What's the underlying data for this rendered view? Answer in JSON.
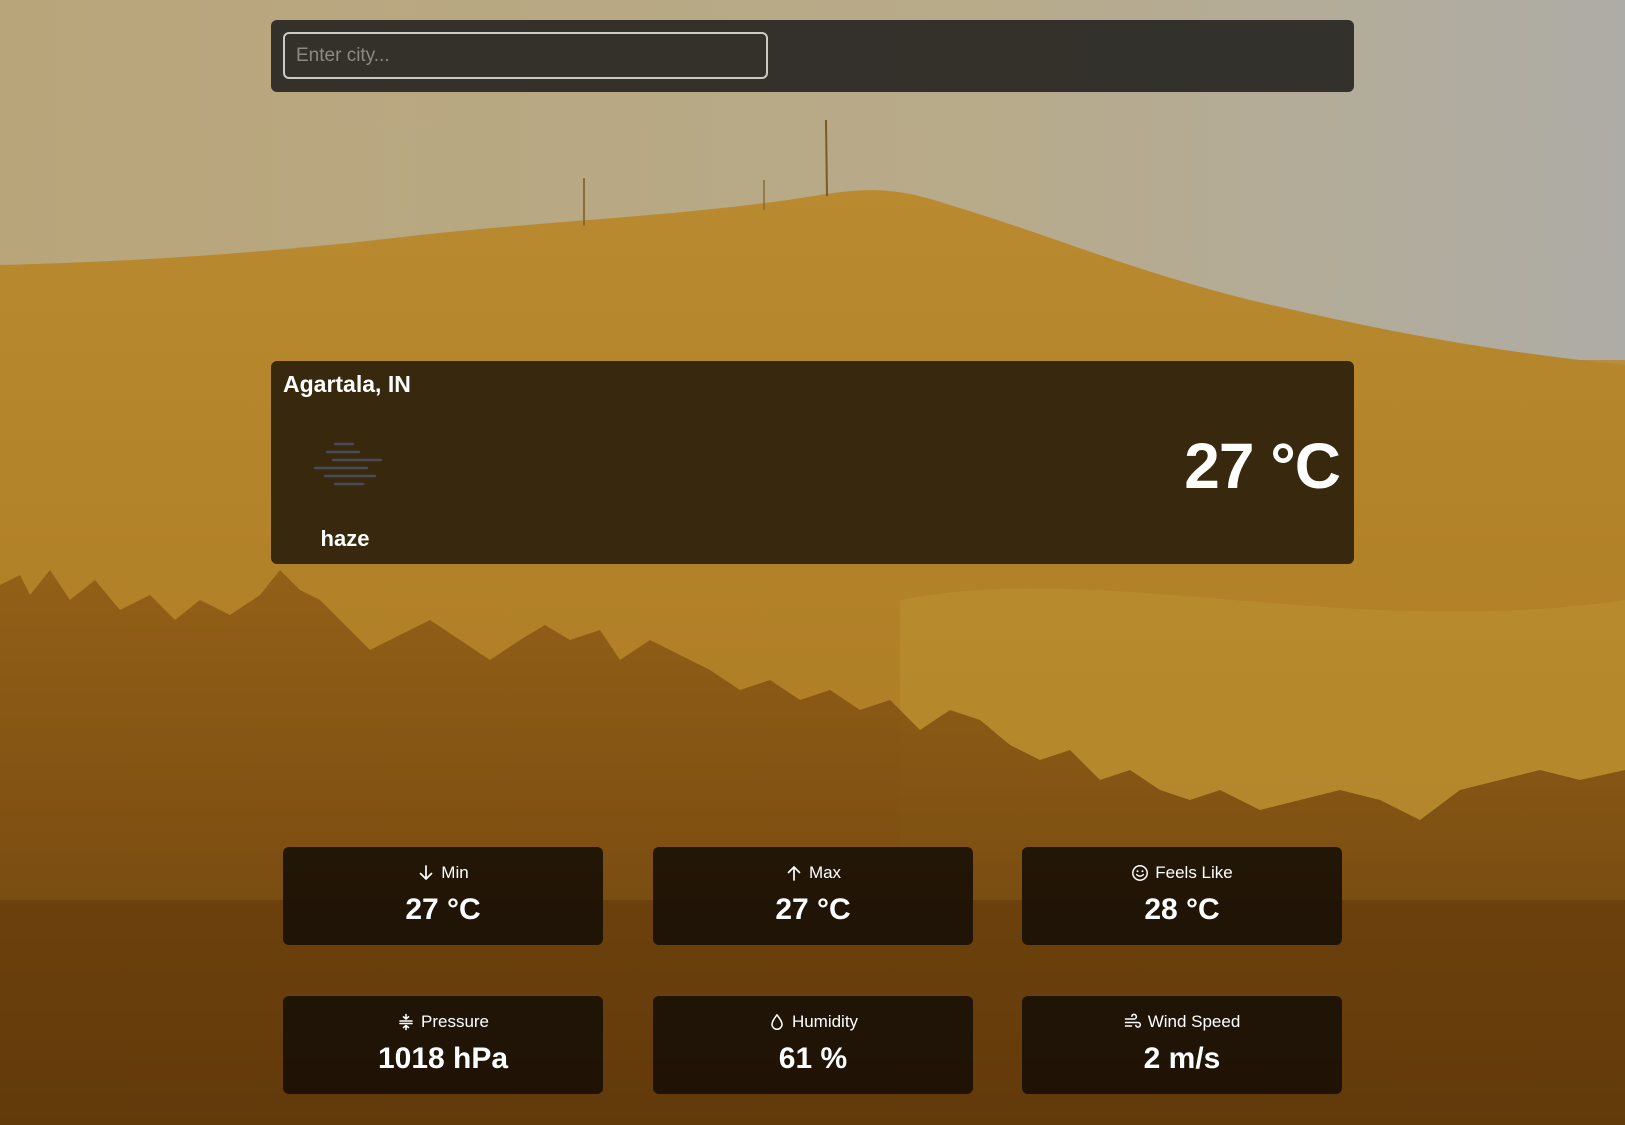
{
  "search": {
    "placeholder": "Enter city...",
    "value": ""
  },
  "current": {
    "city": "Agartala, IN",
    "condition": "haze",
    "icon": "haze-icon",
    "temperature": "27 °C"
  },
  "stats": [
    {
      "label": "Min",
      "icon": "arrow-down-icon",
      "value": "27 °C"
    },
    {
      "label": "Max",
      "icon": "arrow-up-icon",
      "value": "27 °C"
    },
    {
      "label": "Feels Like",
      "icon": "smiley-icon",
      "value": "28 °C"
    },
    {
      "label": "Pressure",
      "icon": "pressure-icon",
      "value": "1018 hPa"
    },
    {
      "label": "Humidity",
      "icon": "droplet-icon",
      "value": "61 %"
    },
    {
      "label": "Wind Speed",
      "icon": "wind-icon",
      "value": "2 m/s"
    }
  ],
  "colors": {
    "card_dark": "#2d210c",
    "stat_card": "#181006",
    "text": "#ffffff"
  }
}
